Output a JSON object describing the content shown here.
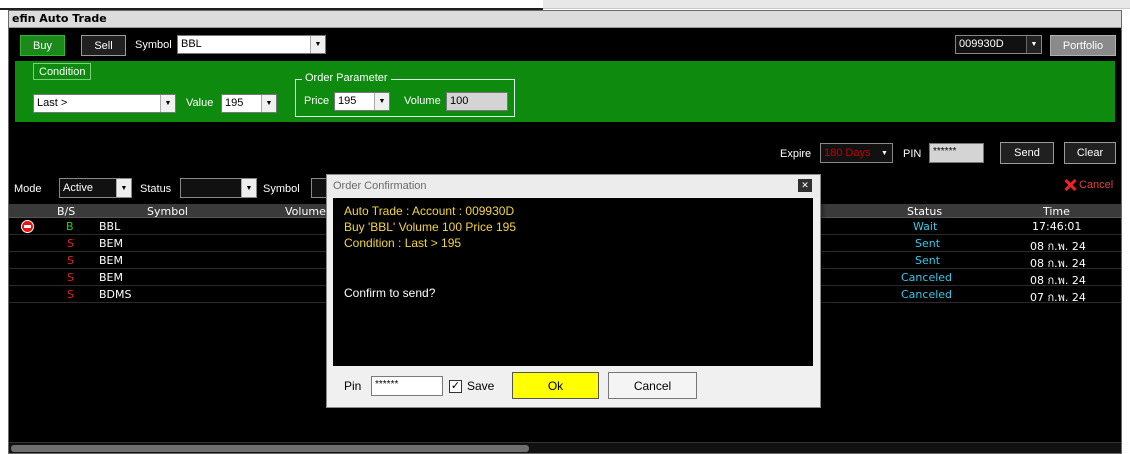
{
  "window": {
    "title": "efin Auto Trade"
  },
  "toolbar": {
    "buy_label": "Buy",
    "sell_label": "Sell",
    "symbol_label": "Symbol",
    "symbol_value": "BBL",
    "account_value": "009930D",
    "portfolio_label": "Portfolio"
  },
  "condition": {
    "tab_label": "Condition",
    "operator_value": "Last >",
    "value_label": "Value",
    "value_value": "195"
  },
  "order_parameter": {
    "legend": "Order Parameter",
    "price_label": "Price",
    "price_value": "195",
    "volume_label": "Volume",
    "volume_value": "100"
  },
  "send_bar": {
    "expire_label": "Expire",
    "expire_value": "180 Days",
    "pin_label": "PIN",
    "pin_value": "******",
    "send_label": "Send",
    "clear_label": "Clear"
  },
  "filter": {
    "mode_label": "Mode",
    "mode_value": "Active",
    "status_label": "Status",
    "status_value": "",
    "symbol_label": "Symbol",
    "cancel_label": "Cancel"
  },
  "grid": {
    "headers": {
      "bs": "B/S",
      "symbol": "Symbol",
      "volume": "Volume",
      "status": "Status",
      "time": "Time"
    },
    "rows": [
      {
        "bs": "B",
        "symbol": "BBL",
        "status": "Wait",
        "time": "17:46:01"
      },
      {
        "bs": "S",
        "symbol": "BEM",
        "status": "Sent",
        "time": "08 ก.พ. 24"
      },
      {
        "bs": "S",
        "symbol": "BEM",
        "status": "Sent",
        "time": "08 ก.พ. 24"
      },
      {
        "bs": "S",
        "symbol": "BEM",
        "status": "Canceled",
        "time": "08 ก.พ. 24"
      },
      {
        "bs": "S",
        "symbol": "BDMS",
        "status": "Canceled",
        "time": "07 ก.พ. 24"
      }
    ]
  },
  "dialog": {
    "title": "Order Confirmation",
    "line1": "Auto Trade : Account : 009930D",
    "line2": "Buy  'BBL'  Volume 100  Price 195",
    "line3": "Condition : Last > 195",
    "confirm": "Confirm to send?",
    "pin_label": "Pin",
    "pin_value": "******",
    "save_label": "Save",
    "save_checked": true,
    "ok_label": "Ok",
    "cancel_label": "Cancel"
  },
  "colors": {
    "panel_green": "#0e8a0e",
    "buy_green": "#1b8a1b",
    "ok_yellow": "#ffff00",
    "dialog_text": "#f3d63a",
    "status_cyan": "#35c8e8",
    "sell_red": "#e02020"
  }
}
